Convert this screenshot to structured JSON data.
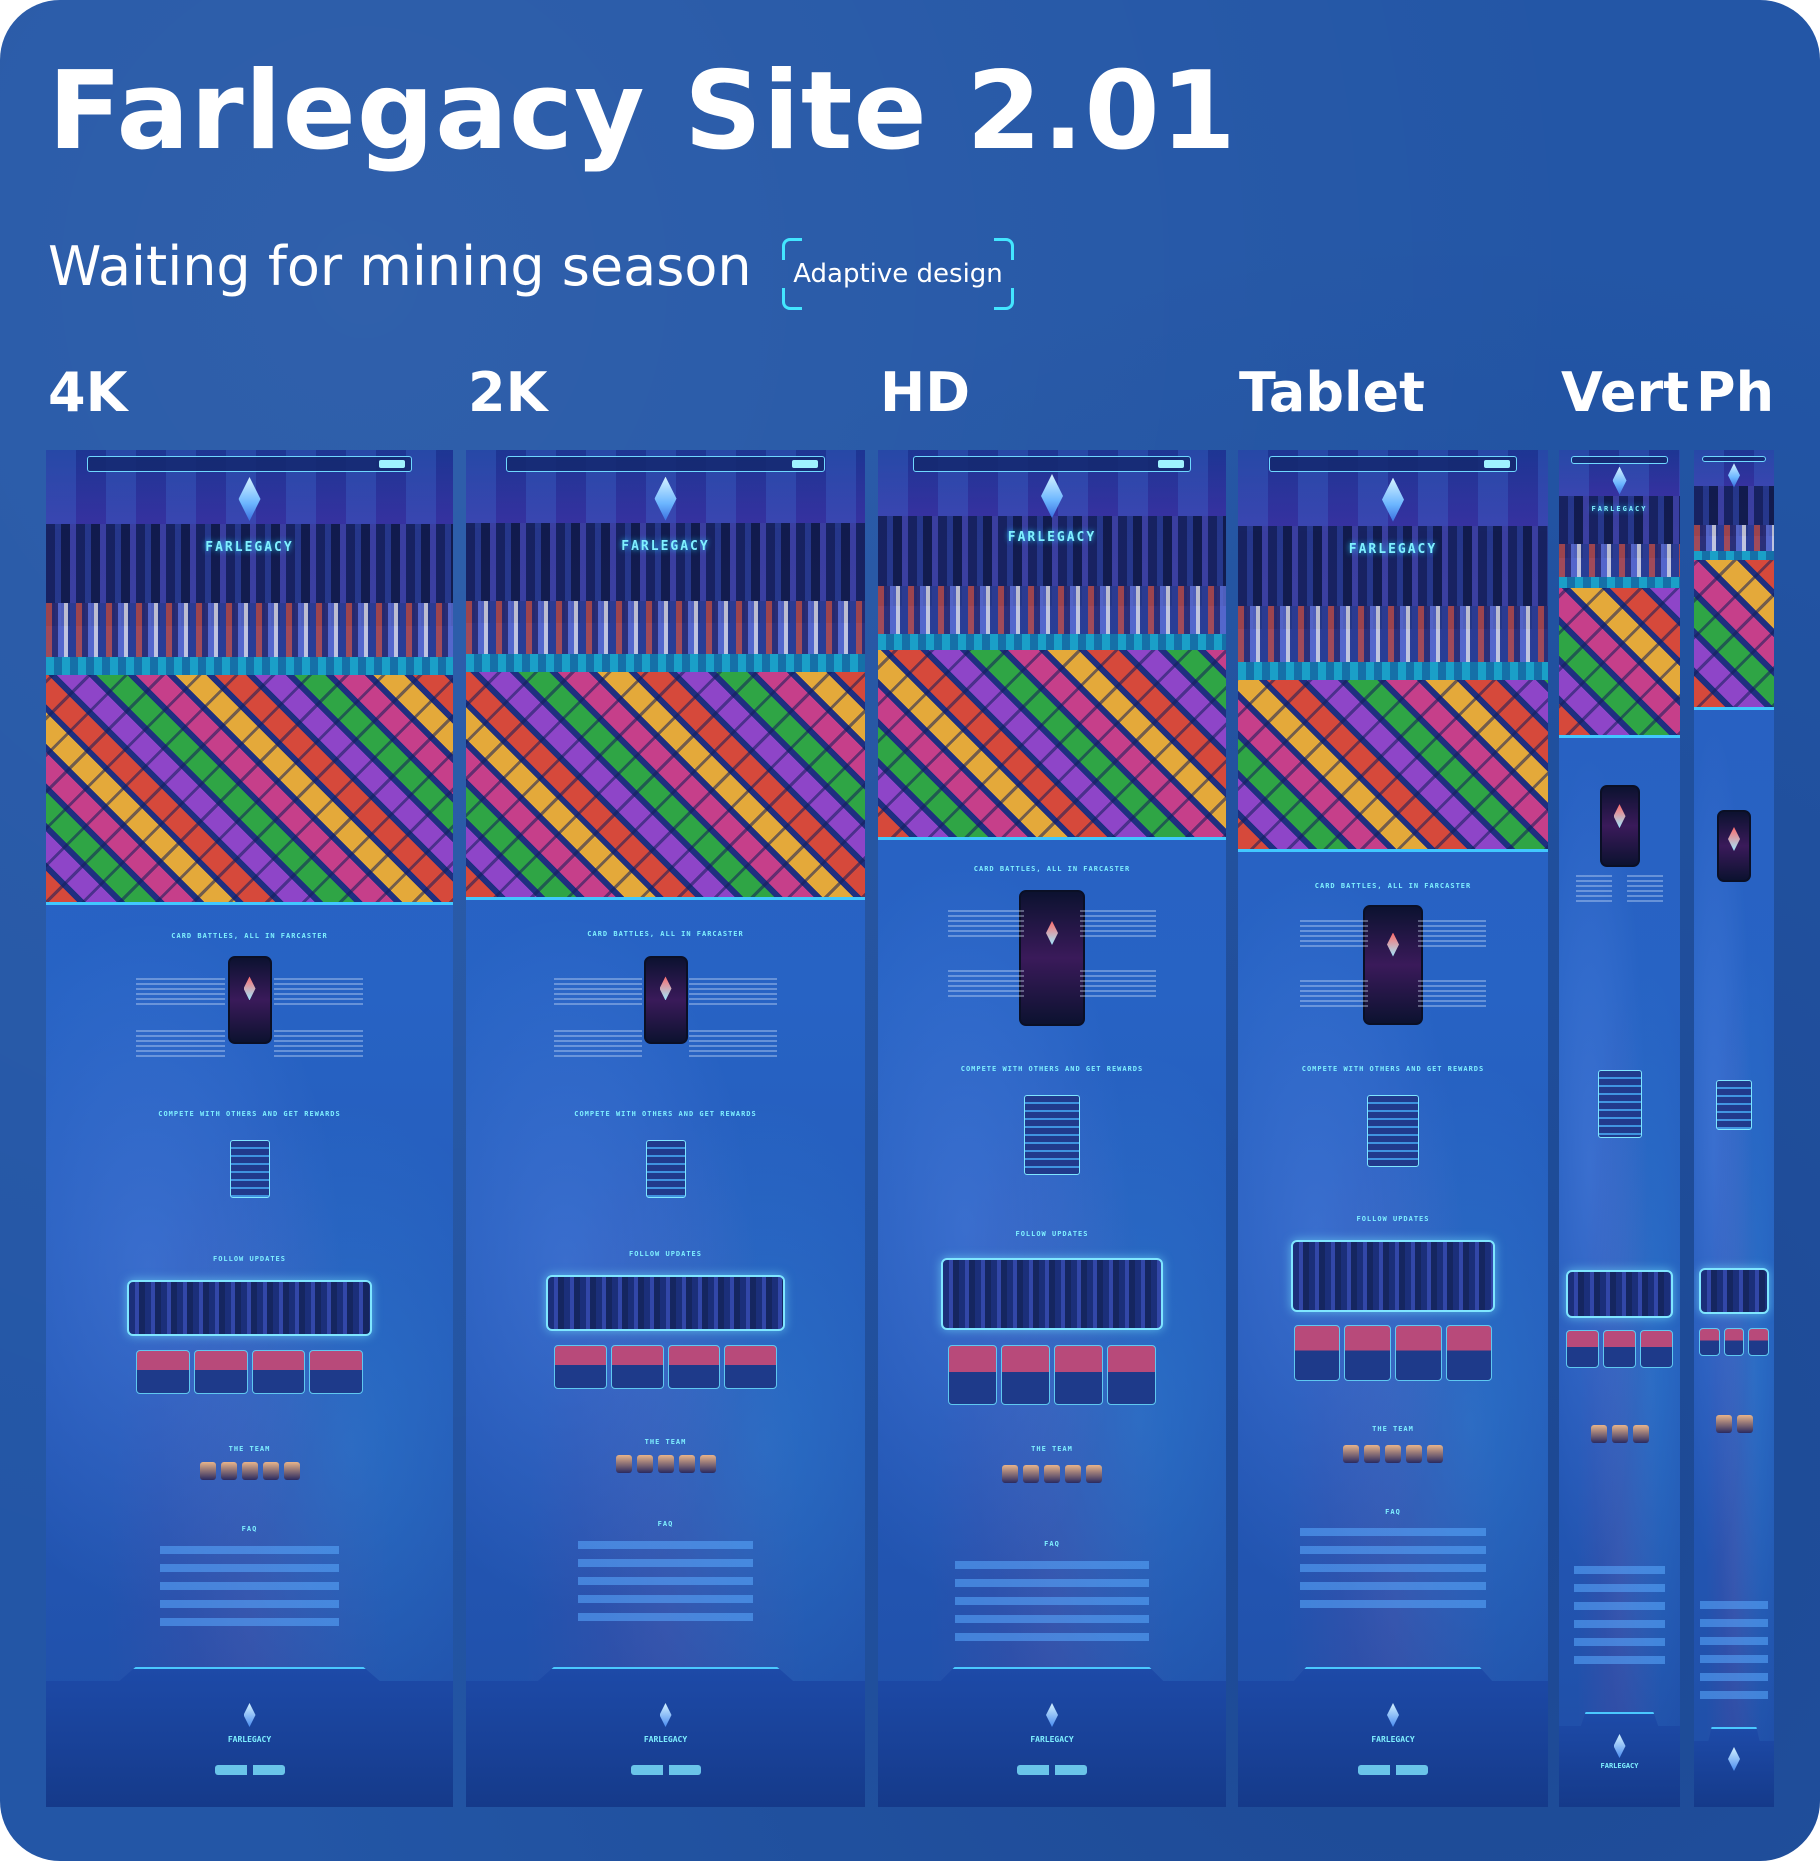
{
  "title": "Farlegacy Site 2.01",
  "subtitle": "Waiting for mining season",
  "badge": "Adaptive design",
  "columns": [
    {
      "label": "4K"
    },
    {
      "label": "2K"
    },
    {
      "label": "HD"
    },
    {
      "label": "Tablet"
    },
    {
      "label": "Vert"
    },
    {
      "label": "Ph"
    }
  ],
  "preview": {
    "logo": "FARLEGACY",
    "section_cards": "CARD BATTLES, ALL IN FARCASTER",
    "section_compete": "COMPETE WITH OTHERS AND GET REWARDS",
    "section_updates": "FOLLOW UPDATES",
    "section_team": "THE TEAM",
    "section_faq": "FAQ"
  },
  "colors": {
    "background": "#2356a6",
    "accent": "#43e6ff"
  }
}
